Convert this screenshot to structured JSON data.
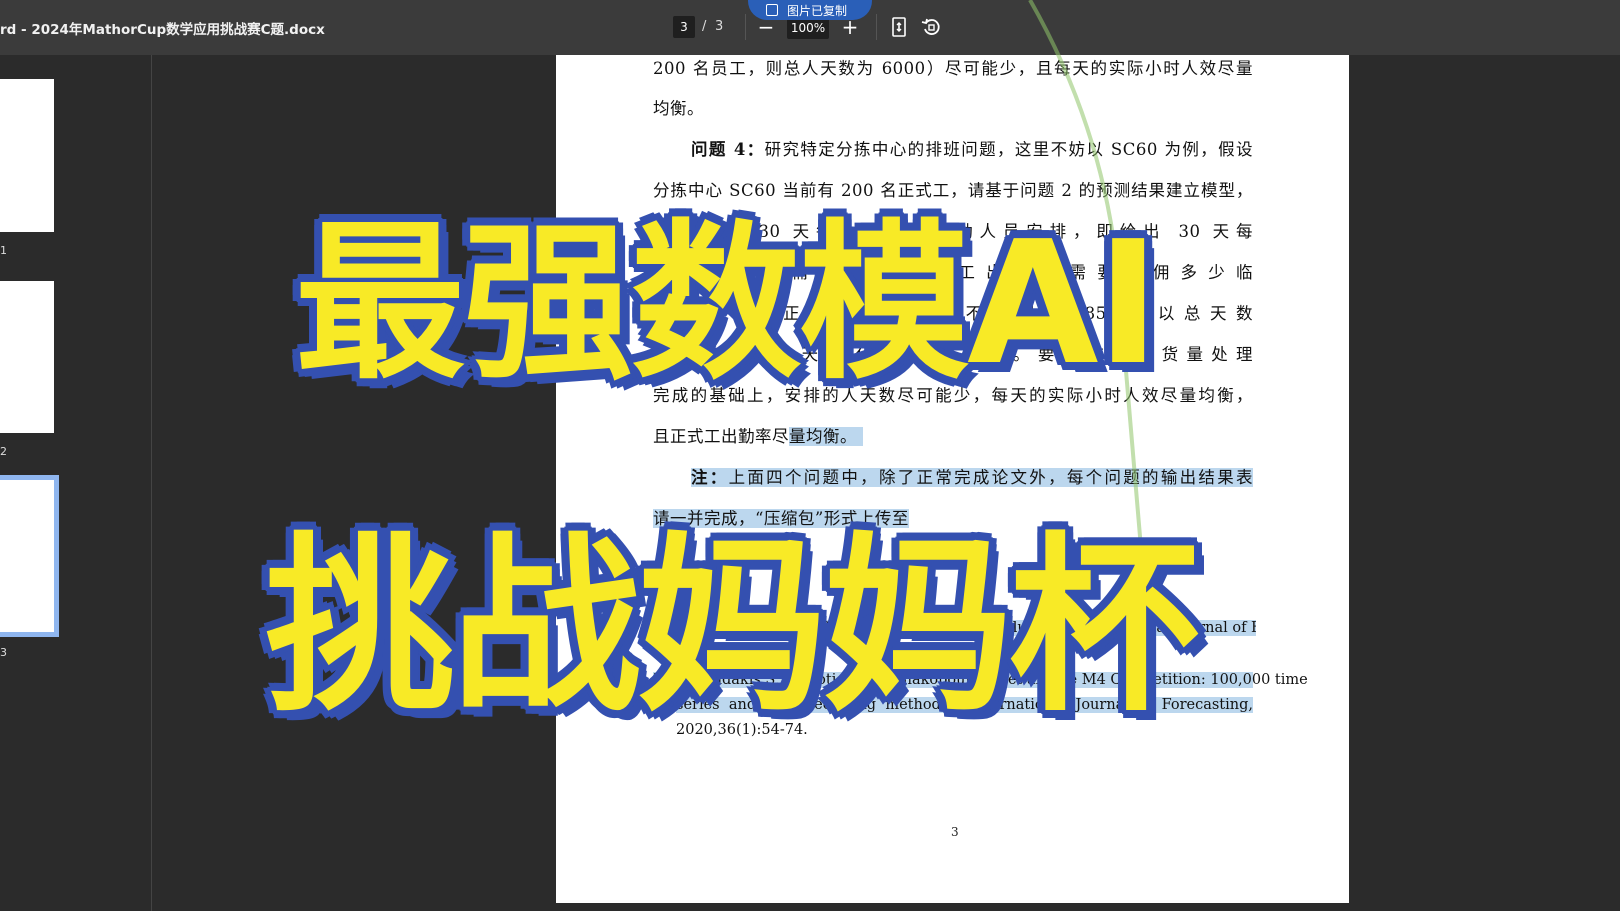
{
  "toolbar": {
    "title": "rd - 2024年MathorCup数学应用挑战赛C题.docx",
    "current_page": "3",
    "separator": "/",
    "total_pages": "3",
    "zoom": "100%",
    "zoom_out": "−",
    "zoom_in": "+",
    "pill_label": "图片已复制"
  },
  "sidebar": {
    "thumbnails": [
      {
        "label": "1",
        "selected": false
      },
      {
        "label": "2",
        "selected": false
      },
      {
        "label": "3",
        "selected": true
      }
    ]
  },
  "document": {
    "lines": [
      "200 名员工，则总人天数为 6000）尽可能少，且每天的实际小时人效尽量",
      "均衡。",
      "问题 4：研究特定分拣中心的排班问题，这里不妨以 SC60 为例，假设",
      "分拣中心 SC60 当前有 200 名正式工，请基于问题 2 的预测结果建立模型，",
      "给出未来 30 天每个班次的出勤人员安排，即给出 30 天每",
      "天每个班次需要哪些正式工出勤，需要雇佣多少临",
      "时工。每名正式工的出勤率不能超过 85%，以总天数",
      "计，连续出勤天数不能超过 7 天。要求在每天货量处理",
      "完成的基础上，安排的人天数尽可能少，每天的实际小时人效尽量均衡，",
      "且正式工出勤率尽量均衡。",
      "注：上面四个问题中，除了正常完成论文外，每个问题的输出结果表",
      "请一并完成，“压缩包”形式上传至"
    ],
    "bold_prefix_q4": "问题 4：",
    "bold_prefix_note": "注：",
    "references": [
      "[1] ...",
      "[2] ... Competition: Results, findings and conclusions. International Journal of Forecasting, 2020,36(1):...27.",
      "[3] Makridakis S, Spiliotis E, Assimakopoulos V, et al. The M4 Competition: 100,000 time",
      "series and 61 forecasting methods[J].International Journal of Forecasting,",
      "2020,36(1):54-74."
    ],
    "page_number": "3"
  },
  "overlay": {
    "line1": "最强数模AI",
    "line2": "挑战妈妈杯"
  },
  "colors": {
    "overlay_fill": "#f8ea26",
    "overlay_outline": "#3450b0",
    "highlight": "#bcd7ee",
    "toolbar_bg": "#3b3b3b",
    "pill_bg": "#2a5fb8"
  },
  "icons": [
    "fit-page-icon",
    "rotate-icon",
    "copy-icon"
  ]
}
